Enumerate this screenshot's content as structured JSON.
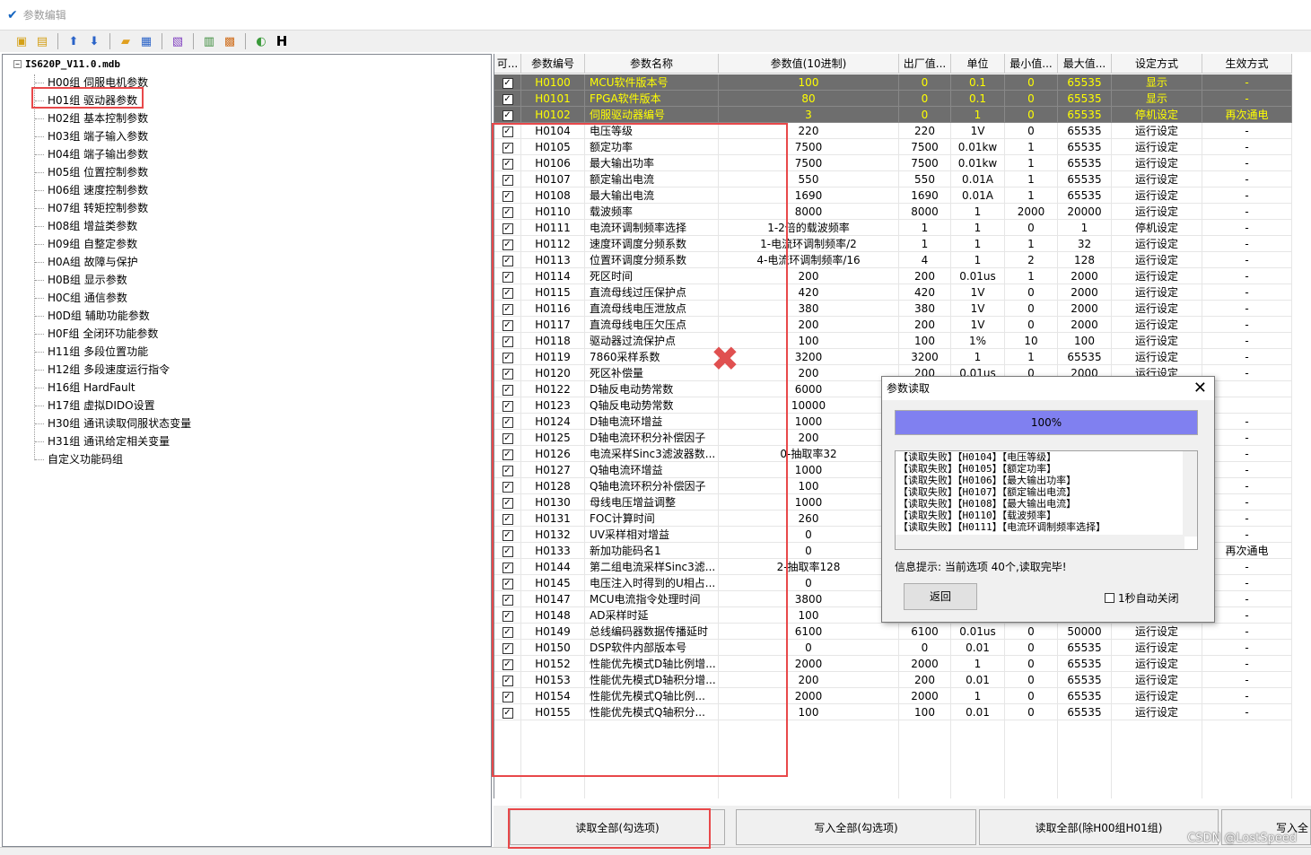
{
  "window": {
    "title": "参数编辑"
  },
  "toolbar": {
    "h_label": "H"
  },
  "tree": {
    "root": "IS620P_V11.0.mdb",
    "items": [
      "H00组 伺服电机参数",
      "H01组 驱动器参数",
      "H02组 基本控制参数",
      "H03组 端子输入参数",
      "H04组 端子输出参数",
      "H05组 位置控制参数",
      "H06组 速度控制参数",
      "H07组 转矩控制参数",
      "H08组 增益类参数",
      "H09组 自整定参数",
      "H0A组 故障与保护",
      "H0B组 显示参数",
      "H0C组 通信参数",
      "H0D组 辅助功能参数",
      "H0F组 全闭环功能参数",
      "H11组 多段位置功能",
      "H12组 多段速度运行指令",
      "H16组 HardFault",
      "H17组 虚拟DIDO设置",
      "H30组 通讯读取伺服状态变量",
      "H31组 通讯给定相关变量",
      "自定义功能码组"
    ]
  },
  "grid": {
    "headers": [
      "可...",
      "参数编号",
      "参数名称",
      "参数值(10进制)",
      "出厂值...",
      "单位",
      "最小值...",
      "最大值...",
      "设定方式",
      "生效方式"
    ],
    "rows": [
      [
        "H0100",
        "MCU软件版本号",
        "100",
        "0",
        "0.1",
        "0",
        "65535",
        "显示",
        "-"
      ],
      [
        "H0101",
        "FPGA软件版本",
        "80",
        "0",
        "0.1",
        "0",
        "65535",
        "显示",
        "-"
      ],
      [
        "H0102",
        "伺服驱动器编号",
        "3",
        "0",
        "1",
        "0",
        "65535",
        "停机设定",
        "再次通电"
      ],
      [
        "H0104",
        "电压等级",
        "220",
        "220",
        "1V",
        "0",
        "65535",
        "运行设定",
        "-"
      ],
      [
        "H0105",
        "额定功率",
        "7500",
        "7500",
        "0.01kw",
        "1",
        "65535",
        "运行设定",
        "-"
      ],
      [
        "H0106",
        "最大输出功率",
        "7500",
        "7500",
        "0.01kw",
        "1",
        "65535",
        "运行设定",
        "-"
      ],
      [
        "H0107",
        "额定输出电流",
        "550",
        "550",
        "0.01A",
        "1",
        "65535",
        "运行设定",
        "-"
      ],
      [
        "H0108",
        "最大输出电流",
        "1690",
        "1690",
        "0.01A",
        "1",
        "65535",
        "运行设定",
        "-"
      ],
      [
        "H0110",
        "载波频率",
        "8000",
        "8000",
        "1",
        "2000",
        "20000",
        "运行设定",
        "-"
      ],
      [
        "H0111",
        "电流环调制频率选择",
        "1-2倍的载波频率",
        "1",
        "1",
        "0",
        "1",
        "停机设定",
        "-"
      ],
      [
        "H0112",
        "速度环调度分频系数",
        "1-电流环调制频率/2",
        "1",
        "1",
        "1",
        "32",
        "运行设定",
        "-"
      ],
      [
        "H0113",
        "位置环调度分频系数",
        "4-电流环调制频率/16",
        "4",
        "1",
        "2",
        "128",
        "运行设定",
        "-"
      ],
      [
        "H0114",
        "死区时间",
        "200",
        "200",
        "0.01us",
        "1",
        "2000",
        "运行设定",
        "-"
      ],
      [
        "H0115",
        "直流母线过压保护点",
        "420",
        "420",
        "1V",
        "0",
        "2000",
        "运行设定",
        "-"
      ],
      [
        "H0116",
        "直流母线电压泄放点",
        "380",
        "380",
        "1V",
        "0",
        "2000",
        "运行设定",
        "-"
      ],
      [
        "H0117",
        "直流母线电压欠压点",
        "200",
        "200",
        "1V",
        "0",
        "2000",
        "运行设定",
        "-"
      ],
      [
        "H0118",
        "驱动器过流保护点",
        "100",
        "100",
        "1%",
        "10",
        "100",
        "运行设定",
        "-"
      ],
      [
        "H0119",
        "7860采样系数",
        "3200",
        "3200",
        "1",
        "1",
        "65535",
        "运行设定",
        "-"
      ],
      [
        "H0120",
        "死区补偿量",
        "200",
        "200",
        "0.01us",
        "0",
        "2000",
        "运行设定",
        "-"
      ],
      [
        "H0122",
        "D轴反电动势常数",
        "6000",
        "",
        "",
        "",
        "",
        "",
        ""
      ],
      [
        "H0123",
        "Q轴反电动势常数",
        "10000",
        "",
        "",
        "",
        "",
        "",
        ""
      ],
      [
        "H0124",
        "D轴电流环增益",
        "1000",
        "",
        "",
        "",
        "",
        "",
        "-"
      ],
      [
        "H0125",
        "D轴电流环积分补偿因子",
        "200",
        "",
        "",
        "",
        "",
        "",
        "-"
      ],
      [
        "H0126",
        "电流采样Sinc3滤波器数...",
        "0-抽取率32",
        "",
        "",
        "",
        "",
        "",
        "-"
      ],
      [
        "H0127",
        "Q轴电流环增益",
        "1000",
        "",
        "",
        "",
        "",
        "",
        "-"
      ],
      [
        "H0128",
        "Q轴电流环积分补偿因子",
        "100",
        "",
        "",
        "",
        "",
        "",
        "-"
      ],
      [
        "H0130",
        "母线电压增益调整",
        "1000",
        "",
        "",
        "",
        "",
        "",
        "-"
      ],
      [
        "H0131",
        "FOC计算时间",
        "260",
        "",
        "",
        "",
        "",
        "",
        "-"
      ],
      [
        "H0132",
        "UV采样相对增益",
        "0",
        "",
        "",
        "",
        "",
        "",
        "-"
      ],
      [
        "H0133",
        "新加功能码名1",
        "0",
        "",
        "",
        "",
        "",
        "",
        "再次通电"
      ],
      [
        "H0144",
        "第二组电流采样Sinc3滤...",
        "2-抽取率128",
        "",
        "",
        "",
        "",
        "",
        "-"
      ],
      [
        "H0145",
        "电压注入时得到的U相占...",
        "0",
        "",
        "",
        "",
        "",
        "",
        "-"
      ],
      [
        "H0147",
        "MCU电流指令处理时间",
        "3800",
        "",
        "",
        "",
        "",
        "",
        "-"
      ],
      [
        "H0148",
        "AD采样时延",
        "100",
        "",
        "",
        "",
        "",
        "",
        "-"
      ],
      [
        "H0149",
        "总线编码器数据传播延时",
        "6100",
        "6100",
        "0.01us",
        "0",
        "50000",
        "运行设定",
        "-"
      ],
      [
        "H0150",
        "DSP软件内部版本号",
        "0",
        "0",
        "0.01",
        "0",
        "65535",
        "运行设定",
        "-"
      ],
      [
        "H0152",
        "性能优先模式D轴比例增...",
        "2000",
        "2000",
        "1",
        "0",
        "65535",
        "运行设定",
        "-"
      ],
      [
        "H0153",
        "性能优先模式D轴积分增...",
        "200",
        "200",
        "0.01",
        "0",
        "65535",
        "运行设定",
        "-"
      ],
      [
        "H0154",
        "性能优先模式Q轴比例...",
        "2000",
        "2000",
        "1",
        "0",
        "65535",
        "运行设定",
        "-"
      ],
      [
        "H0155",
        "性能优先模式Q轴积分...",
        "100",
        "100",
        "0.01",
        "0",
        "65535",
        "运行设定",
        "-"
      ]
    ]
  },
  "buttons": [
    "读取全部(勾选项)",
    "写入全部(勾选项)",
    "读取全部(除H00组H01组)",
    "写入全"
  ],
  "dialog": {
    "title": "参数读取",
    "progress": "100%",
    "progress_value": 1.0,
    "log": [
      "【读取失败】【H0104】【电压等级】",
      "【读取失败】【H0105】【额定功率】",
      "【读取失败】【H0106】【最大输出功率】",
      "【读取失败】【H0107】【额定输出电流】",
      "【读取失败】【H0108】【最大输出电流】",
      "【读取失败】【H0110】【载波频率】",
      "【读取失败】【H0111】【电流环调制频率选择】"
    ],
    "info": "信息提示: 当前选项 40个,读取完毕!",
    "back_button": "返回",
    "autoclose_label": "1秒自动关闭"
  },
  "watermark": "CSDN @LostSpeed"
}
